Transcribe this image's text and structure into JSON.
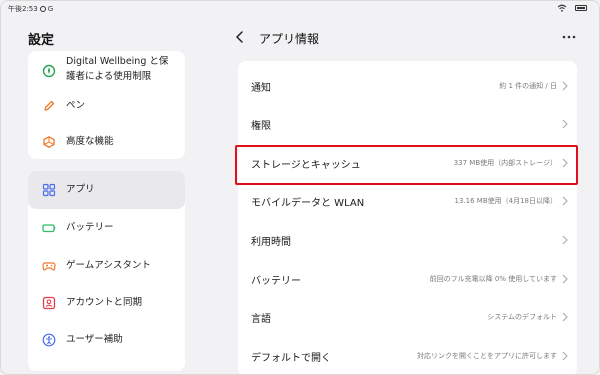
{
  "status_bar": {
    "time": "午後2:53",
    "app_letter": "G"
  },
  "sidebar": {
    "title": "設定",
    "top_items": [
      {
        "label_line1": "Digital Wellbeing と保",
        "label_line2": "護者による使用制限",
        "icon": "wellbeing-icon",
        "color": "#2aa44f"
      },
      {
        "label": "ペン",
        "icon": "pen-icon",
        "color": "#f07a2a"
      },
      {
        "label": "高度な機能",
        "icon": "advanced-features-icon",
        "color": "#f07a2a"
      }
    ],
    "items": [
      {
        "label": "アプリ",
        "icon": "apps-icon",
        "color": "#4a6cf0"
      },
      {
        "label": "バッテリー",
        "icon": "battery-icon",
        "color": "#2bbf6a"
      },
      {
        "label": "ゲームアシスタント",
        "icon": "game-assistant-icon",
        "color": "#f07a2a"
      },
      {
        "label": "アカウントと同期",
        "icon": "account-sync-icon",
        "color": "#e33c4c"
      },
      {
        "label": "ユーザー補助",
        "icon": "accessibility-icon",
        "color": "#4a6cf0"
      }
    ]
  },
  "header": {
    "title": "アプリ情報"
  },
  "rows": [
    {
      "label": "通知",
      "value": "約 1 件の通知 / 日"
    },
    {
      "label": "権限",
      "value": ""
    },
    {
      "label": "ストレージとキャッシュ",
      "value": "337 MB使用（内部ストレージ）"
    },
    {
      "label": "モバイルデータと WLAN",
      "value": "13.16 MB使用（4月18日以降）"
    },
    {
      "label": "利用時間",
      "value": ""
    },
    {
      "label": "バッテリー",
      "value": "前回のフル充電以降 0% 使用しています"
    },
    {
      "label": "言語",
      "value": "システムのデフォルト"
    },
    {
      "label": "デフォルトで開く",
      "value": "対応リンクを開くことをアプリに許可します"
    }
  ],
  "colors": {
    "highlight": "#e0101a",
    "active_bg": "#e9e9eb"
  }
}
